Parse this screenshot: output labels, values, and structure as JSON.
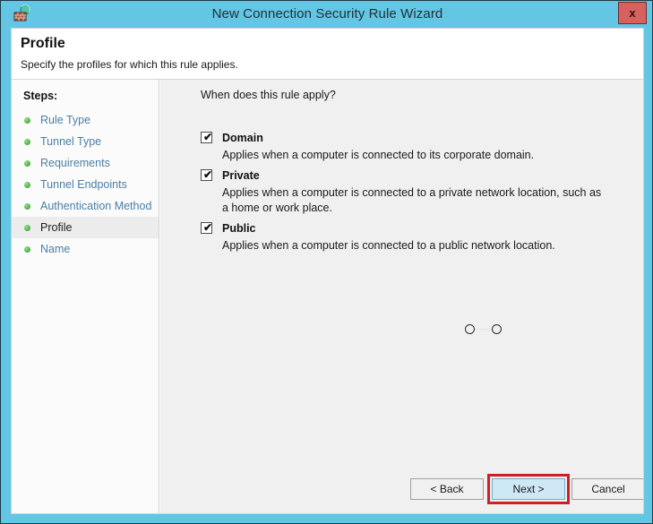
{
  "window": {
    "title": "New Connection Security Rule Wizard",
    "title_icon": "firewall-shield-icon",
    "close_label": "x",
    "frame_color": "#62c6e4"
  },
  "header": {
    "title": "Profile",
    "subtitle": "Specify the profiles for which this rule applies."
  },
  "sidebar": {
    "label": "Steps:",
    "items": [
      {
        "label": "Rule Type",
        "current": false
      },
      {
        "label": "Tunnel Type",
        "current": false
      },
      {
        "label": "Requirements",
        "current": false
      },
      {
        "label": "Tunnel Endpoints",
        "current": false
      },
      {
        "label": "Authentication Method",
        "current": false
      },
      {
        "label": "Profile",
        "current": true
      },
      {
        "label": "Name",
        "current": false
      }
    ]
  },
  "main": {
    "question": "When does this rule apply?",
    "options": [
      {
        "label": "Domain",
        "checked": true,
        "check_glyph": "✔",
        "description": "Applies when a computer is connected to its corporate domain."
      },
      {
        "label": "Private",
        "checked": true,
        "check_glyph": "✔",
        "description": "Applies when a computer is connected to a private network location, such as a home or work place."
      },
      {
        "label": "Public",
        "checked": true,
        "check_glyph": "✔",
        "description": "Applies when a computer is connected to a public network location."
      }
    ]
  },
  "footer": {
    "back_label": "< Back",
    "next_label": "Next >",
    "cancel_label": "Cancel",
    "highlight_color": "#cc2026",
    "highlighted_button": "Next >"
  }
}
